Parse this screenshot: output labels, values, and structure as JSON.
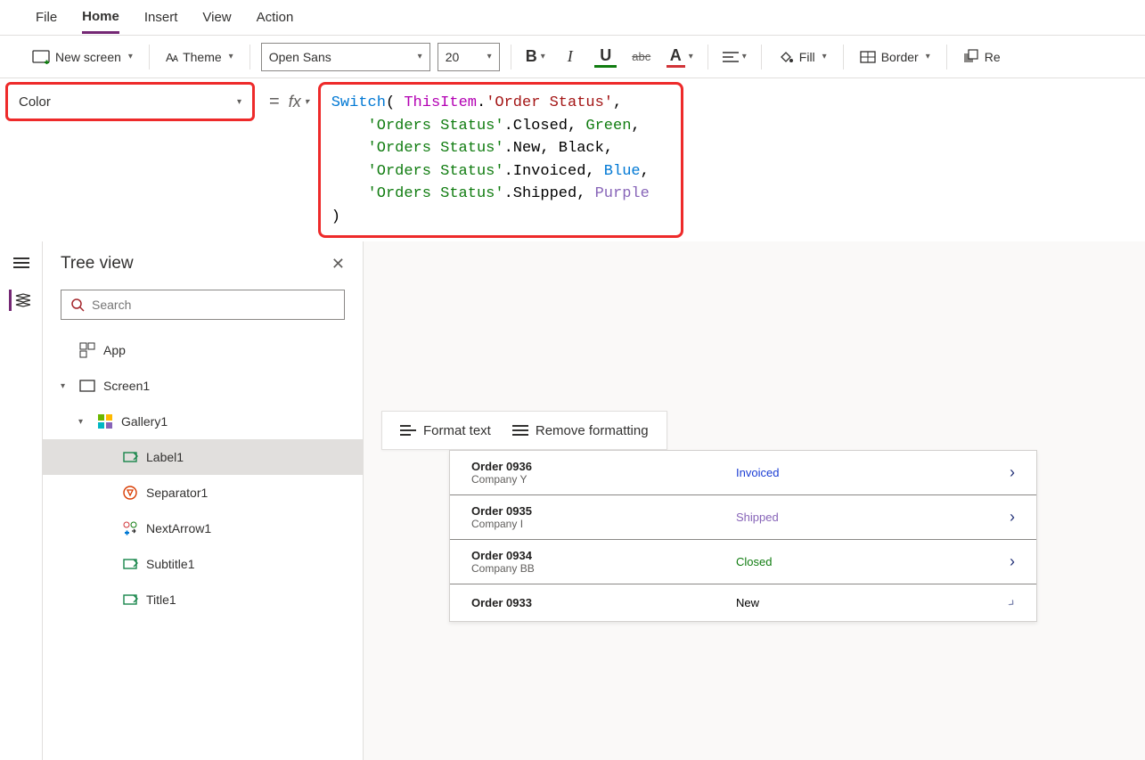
{
  "menubar": {
    "items": [
      "File",
      "Home",
      "Insert",
      "View",
      "Action"
    ],
    "active": "Home"
  },
  "ribbon": {
    "new_screen": "New screen",
    "theme": "Theme",
    "font": "Open Sans",
    "font_size": "20",
    "bold": "B",
    "italic": "I",
    "underline": "U",
    "strike": "abc",
    "font_color": "A",
    "fill": "Fill",
    "border": "Border",
    "reorder": "Re"
  },
  "property_select": "Color",
  "formula_prefix_fx": "fx",
  "formula": {
    "raw": "Switch( ThisItem.'Order Status',\n    'Orders Status'.Closed, Green,\n    'Orders Status'.New, Black,\n    'Orders Status'.Invoiced, Blue,\n    'Orders Status'.Shipped, Purple\n)",
    "line1_a": "Switch",
    "line1_b": "(",
    "line1_c": " ThisItem",
    "line1_d": ".",
    "line1_e": "'Order Status'",
    "line1_f": ",",
    "line2_a": "    'Orders Status'",
    "line2_b": ".Closed, ",
    "line2_c": "Green",
    "line2_d": ",",
    "line3_a": "    'Orders Status'",
    "line3_b": ".New, ",
    "line3_c": "Black",
    "line3_d": ",",
    "line4_a": "    'Orders Status'",
    "line4_b": ".Invoiced, ",
    "line4_c": "Blue",
    "line4_d": ",",
    "line5_a": "    'Orders Status'",
    "line5_b": ".Shipped, ",
    "line5_c": "Purple",
    "line6": ")"
  },
  "tree": {
    "title": "Tree view",
    "search_placeholder": "Search",
    "nodes": {
      "app": "App",
      "screen1": "Screen1",
      "gallery1": "Gallery1",
      "label1": "Label1",
      "separator1": "Separator1",
      "nextarrow1": "NextArrow1",
      "subtitle1": "Subtitle1",
      "title1": "Title1"
    }
  },
  "format_bar": {
    "format_text": "Format text",
    "remove_formatting": "Remove formatting"
  },
  "gallery": [
    {
      "title": "Order 0936",
      "subtitle": "Company Y",
      "status": "Invoiced",
      "status_class": "status-invoiced"
    },
    {
      "title": "Order 0935",
      "subtitle": "Company I",
      "status": "Shipped",
      "status_class": "status-shipped"
    },
    {
      "title": "Order 0934",
      "subtitle": "Company BB",
      "status": "Closed",
      "status_class": "status-closed"
    },
    {
      "title": "Order 0933",
      "subtitle": "",
      "status": "New",
      "status_class": "status-new"
    }
  ],
  "colors": {
    "accent": "#742774",
    "highlight_border": "#ee2a2a"
  }
}
